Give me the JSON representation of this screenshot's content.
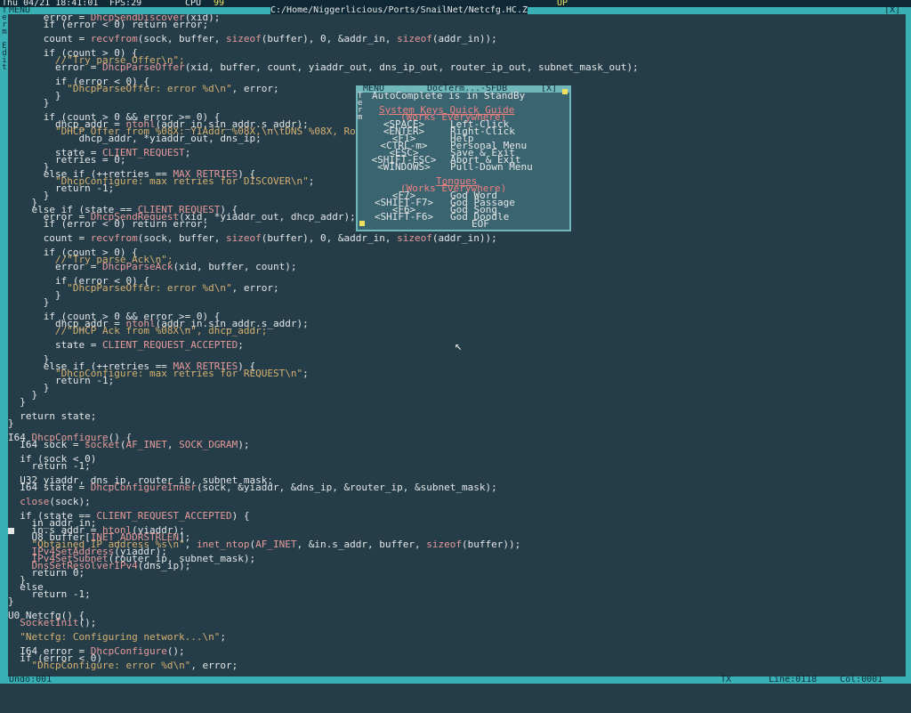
{
  "topbar": {
    "datetime": "Thu 04/21 18:41:01",
    "fps": "FPS:29",
    "cpu_label": "CPU",
    "cpu_value": "99",
    "up_label": "UP"
  },
  "window": {
    "menu_label": "MENU",
    "path": "C:/Home/Niggerlicious/Ports/SnailNet/Netcfg.HC.Z",
    "close_label": "[X]",
    "left_tab_letters": [
      "T",
      "e",
      "r",
      "m",
      "",
      "E",
      "d",
      "i",
      "t"
    ]
  },
  "statusbar": {
    "undo": "Undo:001",
    "tx": "TX",
    "line": "Line:0118",
    "col": "Col:0001"
  },
  "code_lines": [
    {
      "t": "      error = DhcpSendDiscover(xid);"
    },
    {
      "t": "      if (error < 0) return error;"
    },
    {
      "t": ""
    },
    {
      "t": "      count = recvfrom(sock, buffer, sizeof(buffer), 0, &addr_in, sizeof(addr_in));"
    },
    {
      "t": ""
    },
    {
      "t": "      if (count > 0) {"
    },
    {
      "t": "        //\"Try parse Offer\\n\";"
    },
    {
      "t": "        error = DhcpParseOffer(xid, buffer, count, yiaddr_out, dns_ip_out, router_ip_out, subnet_mask_out);"
    },
    {
      "t": ""
    },
    {
      "t": "        if (error < 0) {"
    },
    {
      "t": "          \"DhcpParseOffer: error %d\\n\", error;"
    },
    {
      "t": "        }"
    },
    {
      "t": "      }"
    },
    {
      "t": ""
    },
    {
      "t": "      if (count > 0 && error >= 0) {"
    },
    {
      "t": "        dhcp_addr = ntohl(addr_in.sin_addr.s_addr);"
    },
    {
      "t": "        \"DHCP Offer from %08X: YIAddr %08X,\\n\\tDNS %08X, Router %08X, Subnet %08X\\n\","
    },
    {
      "t": "            dhcp_addr, *yiaddr_out, dns_ip;"
    },
    {
      "t": ""
    },
    {
      "t": "        state = CLIENT_REQUEST;"
    },
    {
      "t": "        retries = 0;"
    },
    {
      "t": "      }"
    },
    {
      "t": "      else if (++retries == MAX_RETRIES) {"
    },
    {
      "t": "        \"DhcpConfigure: max retries for DISCOVER\\n\";"
    },
    {
      "t": "        return -1;"
    },
    {
      "t": "      }"
    },
    {
      "t": "    }"
    },
    {
      "t": "    else if (state == CLIENT_REQUEST) {"
    },
    {
      "t": "      error = DhcpSendRequest(xid, *yiaddr_out, dhcp_addr);"
    },
    {
      "t": "      if (error < 0) return error;"
    },
    {
      "t": ""
    },
    {
      "t": "      count = recvfrom(sock, buffer, sizeof(buffer), 0, &addr_in, sizeof(addr_in));"
    },
    {
      "t": ""
    },
    {
      "t": "      if (count > 0) {"
    },
    {
      "t": "        //\"Try parse Ack\\n\";"
    },
    {
      "t": "        error = DhcpParseAck(xid, buffer, count);"
    },
    {
      "t": ""
    },
    {
      "t": "        if (error < 0) {"
    },
    {
      "t": "          \"DhcpParseOffer: error %d\\n\", error;"
    },
    {
      "t": "        }"
    },
    {
      "t": "      }"
    },
    {
      "t": ""
    },
    {
      "t": "      if (count > 0 && error >= 0) {"
    },
    {
      "t": "        dhcp_addr = ntohl(addr_in.sin_addr.s_addr);"
    },
    {
      "t": "        //\"DHCP Ack from %08X\\n\", dhcp_addr;"
    },
    {
      "t": ""
    },
    {
      "t": "        state = CLIENT_REQUEST_ACCEPTED;"
    },
    {
      "t": ""
    },
    {
      "t": "      }"
    },
    {
      "t": "      else if (++retries == MAX_RETRIES) {"
    },
    {
      "t": "        \"DhcpConfigure: max retries for REQUEST\\n\";"
    },
    {
      "t": "        return -1;"
    },
    {
      "t": "      }"
    },
    {
      "t": "    }"
    },
    {
      "t": "  }"
    },
    {
      "t": ""
    },
    {
      "t": "  return state;"
    },
    {
      "t": "}"
    },
    {
      "t": ""
    },
    {
      "t": "I64 DhcpConfigure() {"
    },
    {
      "t": "  I64 sock = socket(AF_INET, SOCK_DGRAM);"
    },
    {
      "t": ""
    },
    {
      "t": "  if (sock < 0)"
    },
    {
      "t": "    return -1;"
    },
    {
      "t": ""
    },
    {
      "t": "  U32 yiaddr, dns_ip, router_ip, subnet_mask;"
    },
    {
      "t": "  I64 state = DhcpConfigureInner(sock, &yiaddr, &dns_ip, &router_ip, &subnet_mask);"
    },
    {
      "t": ""
    },
    {
      "t": "  close(sock);"
    },
    {
      "t": ""
    },
    {
      "t": "  if (state == CLIENT_REQUEST_ACCEPTED) {"
    },
    {
      "t": "    in_addr in;"
    },
    {
      "t": "    in.s_addr = htonl(yiaddr);"
    },
    {
      "t": "    U8 buffer[INET_ADDRSTRLEN];"
    },
    {
      "t": "    \"Obtained IP address %s\\n\", inet_ntop(AF_INET, &in.s_addr, buffer, sizeof(buffer));"
    },
    {
      "t": "    IPv4SetAddress(yiaddr);"
    },
    {
      "t": "    IPv4SetSubnet(router_ip, subnet_mask);"
    },
    {
      "t": "    DnsSetResolverIPv4(dns_ip);"
    },
    {
      "t": "    return 0;"
    },
    {
      "t": "  }"
    },
    {
      "t": "  else"
    },
    {
      "t": "    return -1;"
    },
    {
      "t": "}"
    },
    {
      "t": ""
    },
    {
      "t": "U0 Netcfg() {"
    },
    {
      "t": "  SocketInit();"
    },
    {
      "t": ""
    },
    {
      "t": "  \"Netcfg: Configuring network...\\n\";"
    },
    {
      "t": ""
    },
    {
      "t": "  I64 error = DhcpConfigure();"
    },
    {
      "t": "  if (error < 0)"
    },
    {
      "t": "    \"DhcpConfigure: error %d\\n\", error;"
    }
  ],
  "popup": {
    "menu_label": "MENU",
    "title": "DocTerm...",
    "extra": "-SFDB",
    "close_label": "[X]",
    "left_letters": [
      "T",
      "e",
      "r",
      "m"
    ],
    "status": "AutoComplete is in StandBy",
    "sys_heading": "System Keys Quick Guide",
    "sys_sub": "(Works Everywhere)",
    "sys_keys": [
      {
        "key": "<SPACE>",
        "desc": "Left-Click"
      },
      {
        "key": "<ENTER>",
        "desc": "Right-Click"
      },
      {
        "key": "<F1>",
        "desc": "Help"
      },
      {
        "key": "<CTRL-m>",
        "desc": "Personal Menu"
      },
      {
        "key": "<ESC>",
        "desc": "Save & Exit"
      },
      {
        "key": "<SHIFT-ESC>",
        "desc": "Abort & Exit"
      },
      {
        "key": "<WINDOWS>",
        "desc": "Pull-Down Menu"
      }
    ],
    "tongues_heading": "Tongues",
    "tongues_sub": "(Works Everywhere)",
    "tongue_keys": [
      {
        "key": "<F7>",
        "desc": "God Word"
      },
      {
        "key": "<SHIFT-F7>",
        "desc": "God Passage"
      },
      {
        "key": "<F6>",
        "desc": "God Song"
      },
      {
        "key": "<SHIFT-F6>",
        "desc": "God Doodle"
      }
    ],
    "eof": "EOF"
  },
  "colors": {
    "background": "#243d49",
    "frame": "#38b0b4",
    "popup_bg": "#3a6470",
    "accent_red": "#f08080",
    "string": "#d8b070"
  }
}
